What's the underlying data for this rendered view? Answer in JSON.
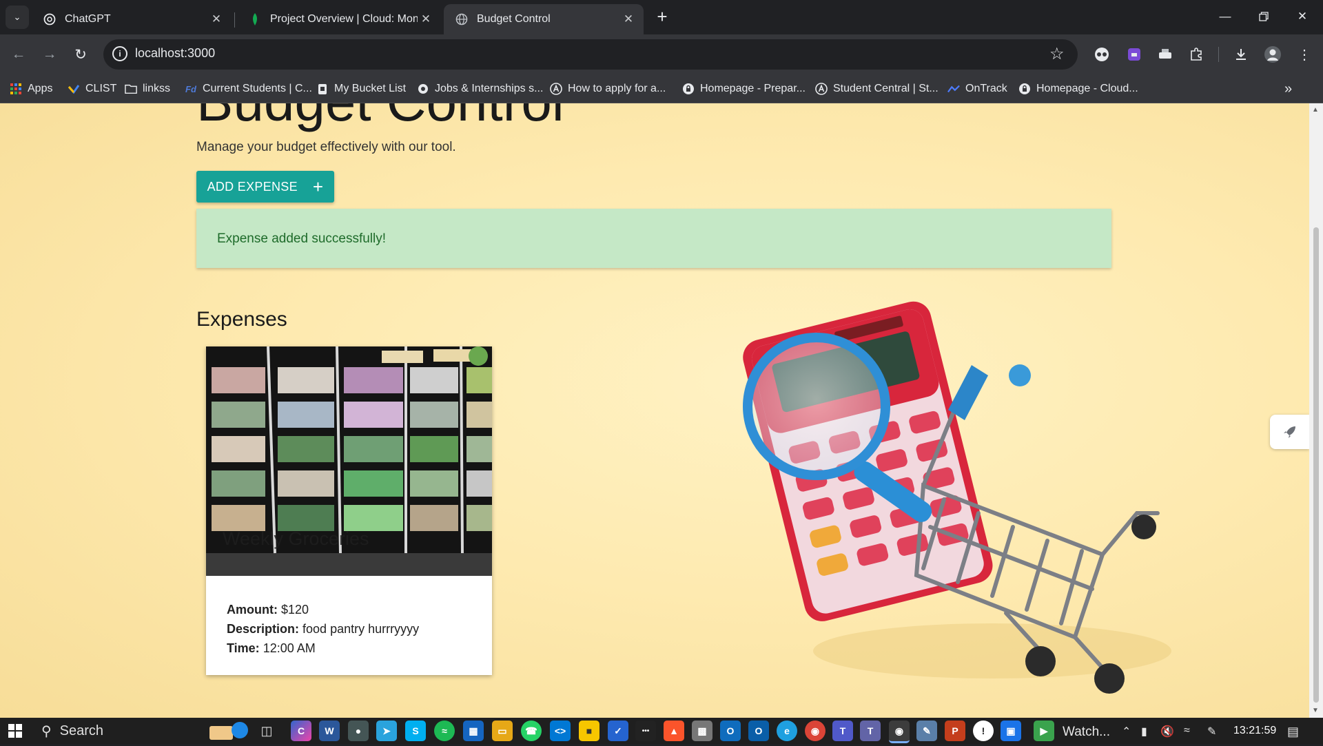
{
  "browser": {
    "tabs": [
      {
        "title": "ChatGPT",
        "icon": "chatgpt-icon",
        "active": false
      },
      {
        "title": "Project Overview | Cloud: Mong",
        "icon": "mongodb-leaf-icon",
        "active": false
      },
      {
        "title": "Budget Control",
        "icon": "globe-icon",
        "active": true
      }
    ],
    "address": "localhost:3000",
    "bookmarks": [
      {
        "label": "Apps",
        "icon": "apps-grid-icon"
      },
      {
        "label": "CLIST",
        "icon": "clist-icon"
      },
      {
        "label": "linkss",
        "icon": "folder-icon"
      },
      {
        "label": "Current Students | C...",
        "icon": "university-icon"
      },
      {
        "label": "My Bucket List",
        "icon": "bucket-icon"
      },
      {
        "label": "Jobs & Internships s...",
        "icon": "jobs-icon"
      },
      {
        "label": "How to apply for a...",
        "icon": "circle-a-icon"
      },
      {
        "label": "Homepage - Prepar...",
        "icon": "lock-circle-icon"
      },
      {
        "label": "Student Central | St...",
        "icon": "circle-a-icon"
      },
      {
        "label": "OnTrack",
        "icon": "ontrack-icon"
      },
      {
        "label": "Homepage - Cloud...",
        "icon": "lock-circle-icon"
      }
    ]
  },
  "page": {
    "title": "Budget Control",
    "subtitle": "Manage your budget effectively with our tool.",
    "add_button": "ADD EXPENSE",
    "add_icon": "+",
    "alert": "Expense added successfully!",
    "section_title": "Expenses",
    "expenses": [
      {
        "title": "Weekly Groceries",
        "amount_label": "Amount:",
        "amount": "$120",
        "description_label": "Description:",
        "description": "food pantry hurrryyyy",
        "time_label": "Time:",
        "time": "12:00 AM"
      }
    ],
    "accent_color": "#17a297",
    "alert_color": "#c5e8c6"
  },
  "taskbar": {
    "search_label": "Search",
    "watch_label": "Watch...",
    "time": "13:21:59"
  }
}
